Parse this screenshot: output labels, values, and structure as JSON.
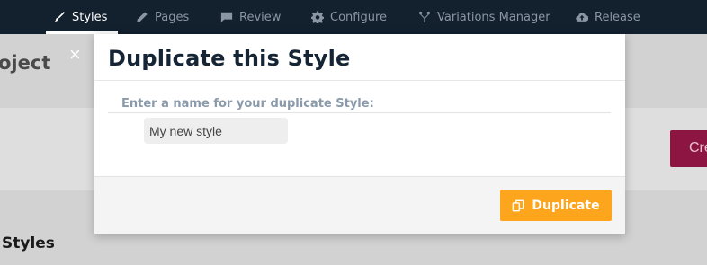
{
  "nav": {
    "items": [
      {
        "label": "Styles",
        "icon": "brush-icon",
        "active": true
      },
      {
        "label": "Pages",
        "icon": "pencil-icon",
        "active": false
      },
      {
        "label": "Review",
        "icon": "comment-icon",
        "active": false
      },
      {
        "label": "Configure",
        "icon": "gear-icon",
        "active": false
      },
      {
        "label": "Variations Manager",
        "icon": "branch-icon",
        "active": false
      },
      {
        "label": "Release",
        "icon": "cloud-upload-icon",
        "active": false
      }
    ]
  },
  "background": {
    "title_fragment": "oject",
    "create_button_fragment": "Cre",
    "section_title": "Styles",
    "close_glyph": "×"
  },
  "modal": {
    "title": "Duplicate this Style",
    "field_label": "Enter a name for your duplicate Style:",
    "input_value": "My new style",
    "duplicate_label": "Duplicate"
  },
  "colors": {
    "nav_bg": "#13202e",
    "accent": "#fda51c",
    "create_button": "#8c1641"
  }
}
